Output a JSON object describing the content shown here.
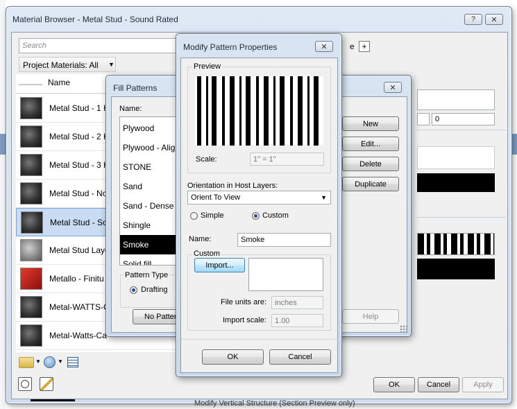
{
  "material_browser": {
    "title": "Material Browser - Metal Stud - Sound Rated",
    "help_btn": "?",
    "close_btn": "✕",
    "search_placeholder": "Search",
    "breadcrumb": "Project Materials: All",
    "column_name": "Name",
    "rows": [
      {
        "label": "Metal Stud - 1 H",
        "thumb": "dark"
      },
      {
        "label": "Metal Stud - 2 H",
        "thumb": "dark"
      },
      {
        "label": "Metal Stud - 3 H",
        "thumb": "dark"
      },
      {
        "label": "Metal Stud - No",
        "thumb": "dark"
      },
      {
        "label": "Metal Stud - So",
        "thumb": "dark",
        "selected": true
      },
      {
        "label": "Metal Stud Laye",
        "thumb": "grey"
      },
      {
        "label": "Metallo - Finitu",
        "thumb": "red"
      },
      {
        "label": "Metal-WATTS-C",
        "thumb": "dark"
      },
      {
        "label": "Metal-Watts-Ca",
        "thumb": "dark"
      }
    ],
    "right_fields": {
      "value0": "0"
    },
    "add_tab": "+",
    "tab_partial": "e",
    "ok": "OK",
    "cancel": "Cancel",
    "apply": "Apply",
    "bottom_status": "Modify Vertical Structure (Section Preview only)"
  },
  "fill_patterns": {
    "title": "Fill Patterns",
    "close_btn": "✕",
    "name_label": "Name:",
    "items": [
      "Plywood",
      "Plywood - Alig",
      "STONE",
      "Sand",
      "Sand - Dense",
      "Shingle",
      "Smoke",
      "Solid fill"
    ],
    "selected_index": 6,
    "pattern_type_label": "Pattern Type",
    "drafting_label": "Drafting",
    "no_pattern_btn": "No Patter",
    "new_btn": "New",
    "edit_btn": "Edit...",
    "delete_btn": "Delete",
    "duplicate_btn": "Duplicate",
    "help_btn": "Help"
  },
  "modify_pattern": {
    "title": "Modify Pattern Properties",
    "close_btn": "✕",
    "preview_label": "Preview",
    "scale_label": "Scale:",
    "scale_value": "1\" = 1\"",
    "orientation_label": "Orientation in Host Layers:",
    "orientation_value": "Orient To View",
    "simple_label": "Simple",
    "custom_label": "Custom",
    "name_label": "Name:",
    "name_value": "Smoke",
    "custom_group": "Custom",
    "import_btn": "Import...",
    "file_units_label": "File units are:",
    "file_units_value": "inches",
    "import_scale_label": "Import scale:",
    "import_scale_value": "1.00",
    "ok": "OK",
    "cancel": "Cancel"
  }
}
